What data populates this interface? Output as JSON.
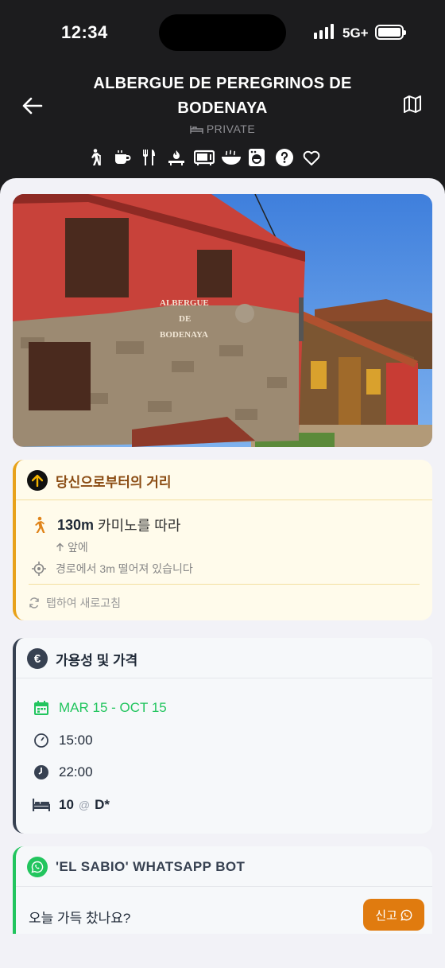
{
  "status_bar": {
    "time": "12:34",
    "network": "5G+"
  },
  "header": {
    "title": "ALBERGUE DE PEREGRINOS DE BODENAYA",
    "type_label": "PRIVATE",
    "amenity_icons": [
      "hiker-icon",
      "coffee-icon",
      "restaurant-icon",
      "kitchen-icon",
      "microwave-icon",
      "meal-icon",
      "washing-machine-icon",
      "help-icon",
      "favorite-icon"
    ]
  },
  "photo": {
    "sign_line1": "ALBERGUE",
    "sign_line2": "DE",
    "sign_line3": "BODENAYA"
  },
  "distance_card": {
    "title": "당신으로부터의 거리",
    "distance": "130m",
    "distance_suffix": "카미노를 따라",
    "direction": "앞에",
    "off_route": "경로에서 3m 떨어져 있습니다",
    "refresh_hint": "탭하여 새로고침"
  },
  "availability_card": {
    "title": "가용성 및 가격",
    "season": "MAR 15 - OCT 15",
    "checkin_time": "15:00",
    "curfew_time": "22:00",
    "beds": "10",
    "at_symbol": "@",
    "price": "D*"
  },
  "bot_card": {
    "title": "'EL SABIO' WHATSAPP BOT",
    "question": "오늘 가득 찼나요?",
    "report_label": "신고"
  },
  "colors": {
    "accent_orange": "#e07b0f",
    "season_green": "#22c55e",
    "distance_border": "#e8a21a"
  }
}
